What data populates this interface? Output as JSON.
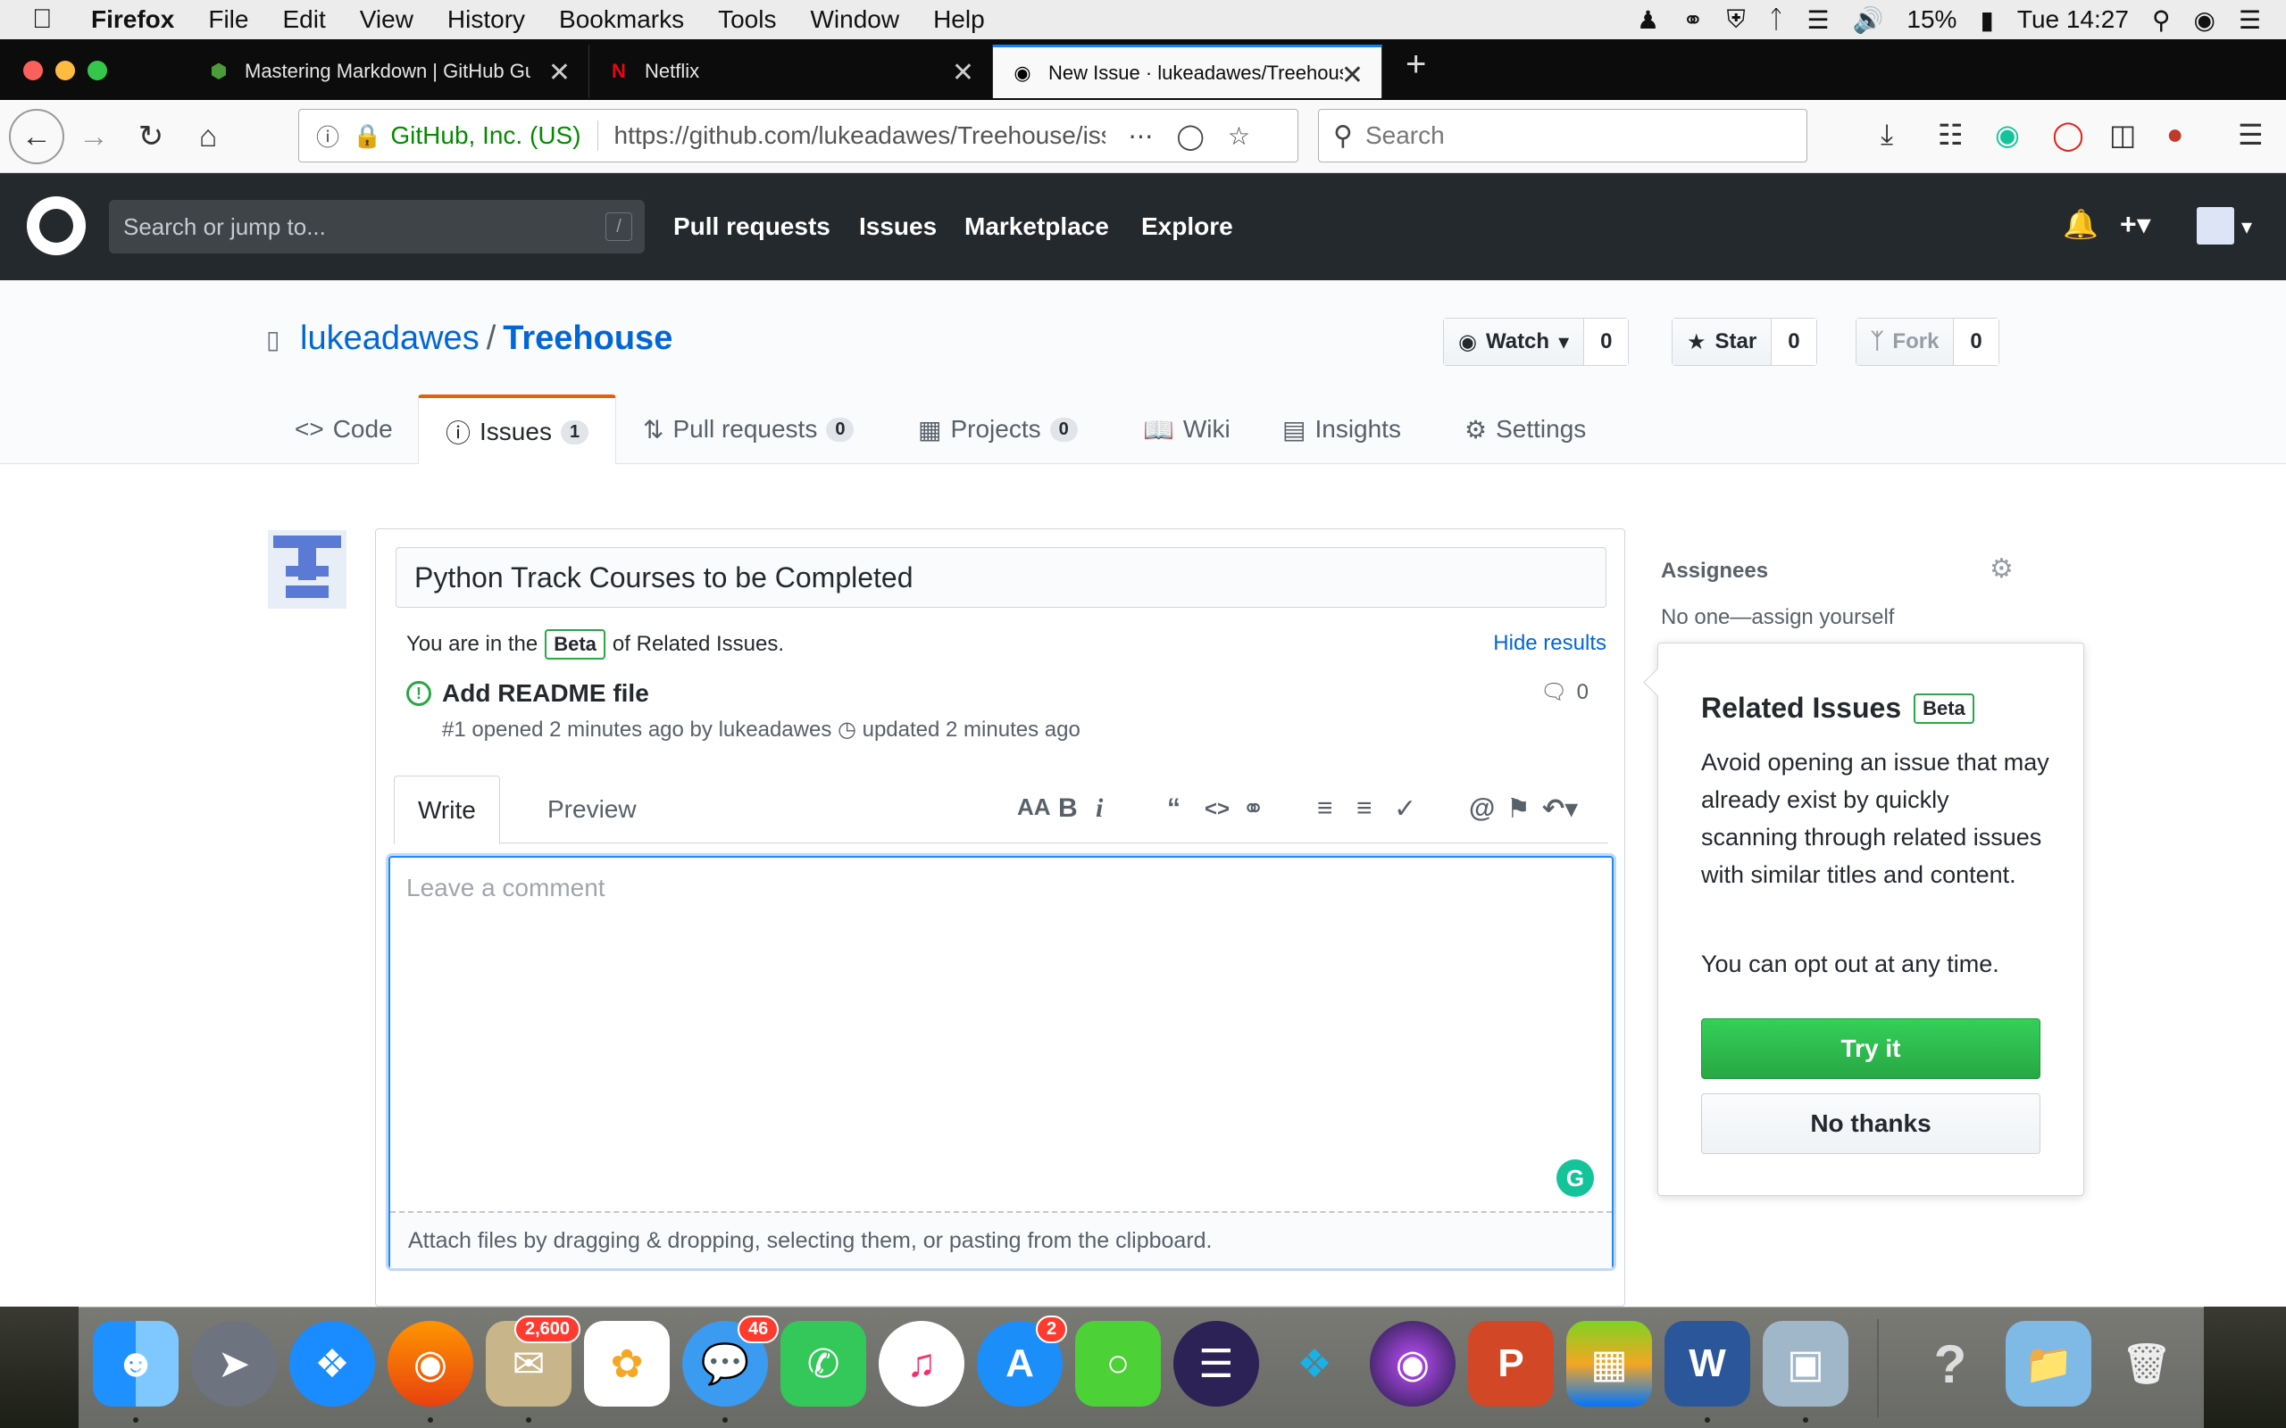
{
  "menubar": {
    "app": "Firefox",
    "items": [
      "File",
      "Edit",
      "View",
      "History",
      "Bookmarks",
      "Tools",
      "Window",
      "Help"
    ],
    "battery": "15%",
    "clock": "Tue 14:27"
  },
  "browser": {
    "tabs": [
      {
        "title": "Mastering Markdown | GitHub Guides"
      },
      {
        "title": "Netflix"
      },
      {
        "title": "New Issue · lukeadawes/Treehouse"
      }
    ],
    "identity": "GitHub, Inc. (US)",
    "url": "https://github.com/lukeadawes/Treehouse/issues/new",
    "search_placeholder": "Search"
  },
  "github": {
    "search_placeholder": "Search or jump to...",
    "search_key": "/",
    "nav": [
      "Pull requests",
      "Issues",
      "Marketplace",
      "Explore"
    ]
  },
  "repo": {
    "owner": "lukeadawes",
    "separator": "/",
    "name": "Treehouse",
    "watch_label": "Watch",
    "watch_count": "0",
    "star_label": "Star",
    "star_count": "0",
    "fork_label": "Fork",
    "fork_count": "0",
    "tabs": [
      {
        "label": "Code",
        "count": ""
      },
      {
        "label": "Issues",
        "count": "1"
      },
      {
        "label": "Pull requests",
        "count": "0"
      },
      {
        "label": "Projects",
        "count": "0"
      },
      {
        "label": "Wiki",
        "count": ""
      },
      {
        "label": "Insights",
        "count": ""
      },
      {
        "label": "Settings",
        "count": ""
      }
    ]
  },
  "issue_form": {
    "title_value": "Python Track Courses to be Completed",
    "related_prefix": "You are in the",
    "related_badge": "Beta",
    "related_suffix": "of Related Issues.",
    "hide_results": "Hide results",
    "related_issue": {
      "title": "Add README file",
      "meta_opened": "#1 opened 2 minutes ago by lukeadawes",
      "meta_updated": "updated 2 minutes ago",
      "comments": "0"
    },
    "tab_write": "Write",
    "tab_preview": "Preview",
    "comment_placeholder": "Leave a comment",
    "attach_hint": "Attach files by dragging & dropping, selecting them, or pasting from the clipboard."
  },
  "sidebar": {
    "assignees_title": "Assignees",
    "assignees_value": "No one—assign yourself"
  },
  "popover": {
    "title": "Related Issues",
    "badge": "Beta",
    "body": "Avoid opening an issue that may already exist by quickly scanning through related issues with similar titles and content.",
    "opt_out": "You can opt out at any time.",
    "try_label": "Try it",
    "decline_label": "No thanks"
  },
  "dock": {
    "mail_badge": "2,600",
    "messages_badge": "46",
    "appstore_badge": "2"
  },
  "colors": {
    "accent": "#0366d6",
    "green": "#28a745",
    "header_dark": "#24292e",
    "issues_tab_indicator": "#e36209"
  }
}
